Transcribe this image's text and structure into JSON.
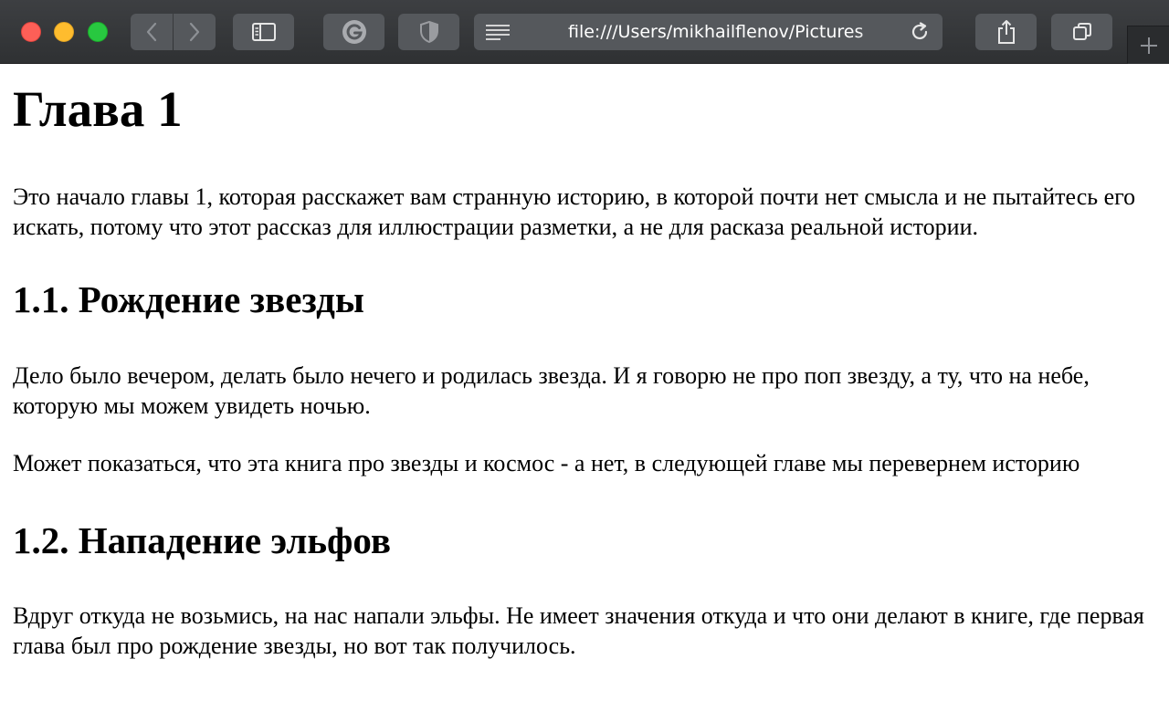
{
  "browser": {
    "url": "file:///Users/mikhailflenov/Pictures",
    "icons": {
      "back": "chevron-left-icon",
      "forward": "chevron-right-icon",
      "sidebar": "sidebar-icon",
      "grammarly": "grammarly-icon",
      "shield": "shield-icon",
      "reader": "reader-lines-icon",
      "reload": "reload-icon",
      "share": "share-icon",
      "tabs": "tabs-overview-icon",
      "new_tab": "plus-icon"
    }
  },
  "document": {
    "title": "Глава 1",
    "intro": "Это начало главы 1, которая расскажет вам странную историю, в которой почти нет смысла и не пытайтесь его искать, потому что этот рассказ для иллюстрации разметки, а не для расказа реальной истории.",
    "sections": [
      {
        "heading": "1.1. Рождение звезды",
        "paragraphs": [
          "Дело было вечером, делать было нечего и родилась звезда. И я говорю не про поп звезду, а ту, что на небе, которую мы можем увидеть ночью.",
          "Может показаться, что эта книга про звезды и космос - а нет, в следующей главе мы перевернем историю"
        ]
      },
      {
        "heading": "1.2. Нападение эльфов",
        "paragraphs": [
          "Вдруг откуда не возьмись, на нас напали эльфы. Не имеет значения откуда и что они делают в книге, где первая глава был про рождение звезды, но вот так получилось."
        ]
      }
    ]
  }
}
